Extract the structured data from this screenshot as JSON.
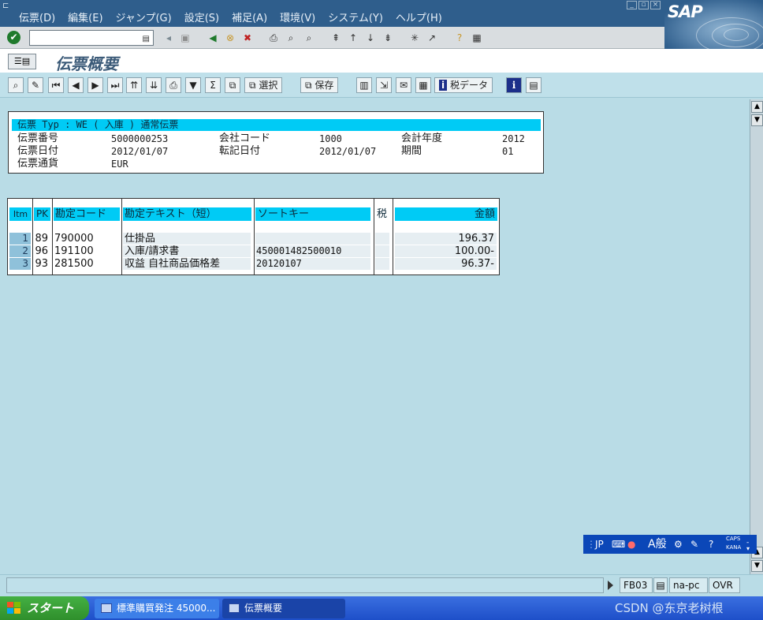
{
  "menubar": {
    "items": [
      "伝票(D)",
      "編集(E)",
      "ジャンプ(G)",
      "設定(S)",
      "補足(A)",
      "環境(V)",
      "システム(Y)",
      "ヘルプ(H)"
    ],
    "brand": "SAP"
  },
  "command_field": {
    "value": ""
  },
  "screen": {
    "title": "伝票概要"
  },
  "app_toolbar": {
    "select_label": "選択",
    "save_label": "保存",
    "tax_data_label": "税データ"
  },
  "header": {
    "doc_type_line": "伝票 Typ : WE ( 入庫 ) 通常伝票",
    "doc_number_label": "伝票番号",
    "doc_number": "5000000253",
    "company_code_label": "会社コード",
    "company_code": "1000",
    "fiscal_year_label": "会計年度",
    "fiscal_year": "2012",
    "doc_date_label": "伝票日付",
    "doc_date": "2012/01/07",
    "posting_date_label": "転記日付",
    "posting_date": "2012/01/07",
    "period_label": "期間",
    "period": "01",
    "currency_label": "伝票通貨",
    "currency": "EUR"
  },
  "items_table": {
    "columns": [
      "Itm",
      "PK",
      "勘定コード",
      "勘定テキスト（短）",
      "ソートキー",
      "税",
      "金額"
    ],
    "rows": [
      {
        "itm": "1",
        "pk": "89",
        "account": "790000",
        "text": "仕掛品",
        "sort_key": "",
        "tax": "",
        "amount": "196.37"
      },
      {
        "itm": "2",
        "pk": "96",
        "account": "191100",
        "text": "入庫/請求書",
        "sort_key": "450001482500010",
        "tax": "",
        "amount": "100.00-"
      },
      {
        "itm": "3",
        "pk": "93",
        "account": "281500",
        "text": "収益 自社商品価格差",
        "sort_key": "20120107",
        "tax": "",
        "amount": "96.37-"
      }
    ]
  },
  "ime_bar": {
    "lang": "JP",
    "mode": "A般",
    "caps": "CAPS",
    "kana": "KANA"
  },
  "status": {
    "transaction": "FB03",
    "server": "na-pc",
    "mode": "OVR"
  },
  "taskbar": {
    "start_label": "スタート",
    "windows": [
      "標準購買発注 45000...",
      "伝票概要"
    ]
  },
  "watermark": "CSDN @东京老树根",
  "colors": {
    "menubar": "#2f5e8c",
    "background": "#b9dce6",
    "header_highlight": "#00cbf5",
    "taskbar": "#245edb",
    "start_button": "#3a9a38"
  }
}
